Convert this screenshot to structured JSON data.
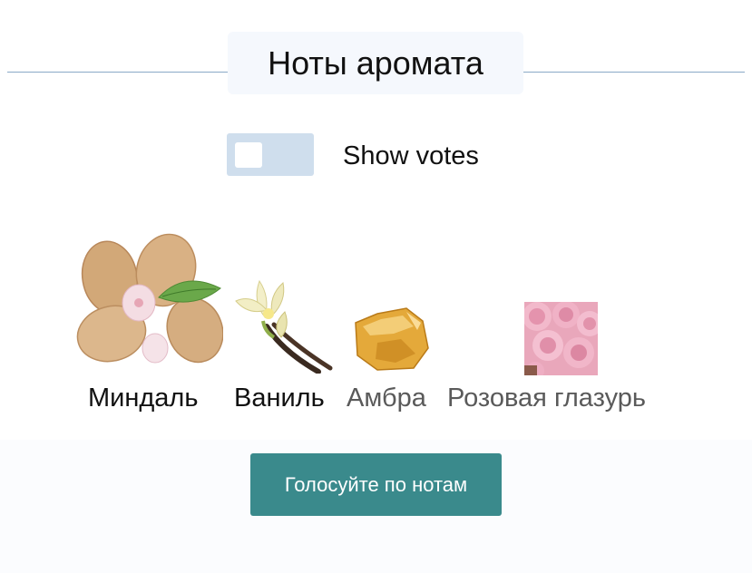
{
  "section": {
    "title": "Ноты аромата"
  },
  "toggle": {
    "label": "Show votes",
    "checked": false
  },
  "notes": [
    {
      "name": "Миндаль",
      "color": "#111111"
    },
    {
      "name": "Ваниль",
      "color": "#111111"
    },
    {
      "name": "Амбра",
      "color": "#5a5a5a"
    },
    {
      "name": "Розовая глазурь",
      "color": "#5a5a5a"
    }
  ],
  "vote_button": {
    "label": "Голосуйте по нотам",
    "color": "#3a8a8c"
  }
}
